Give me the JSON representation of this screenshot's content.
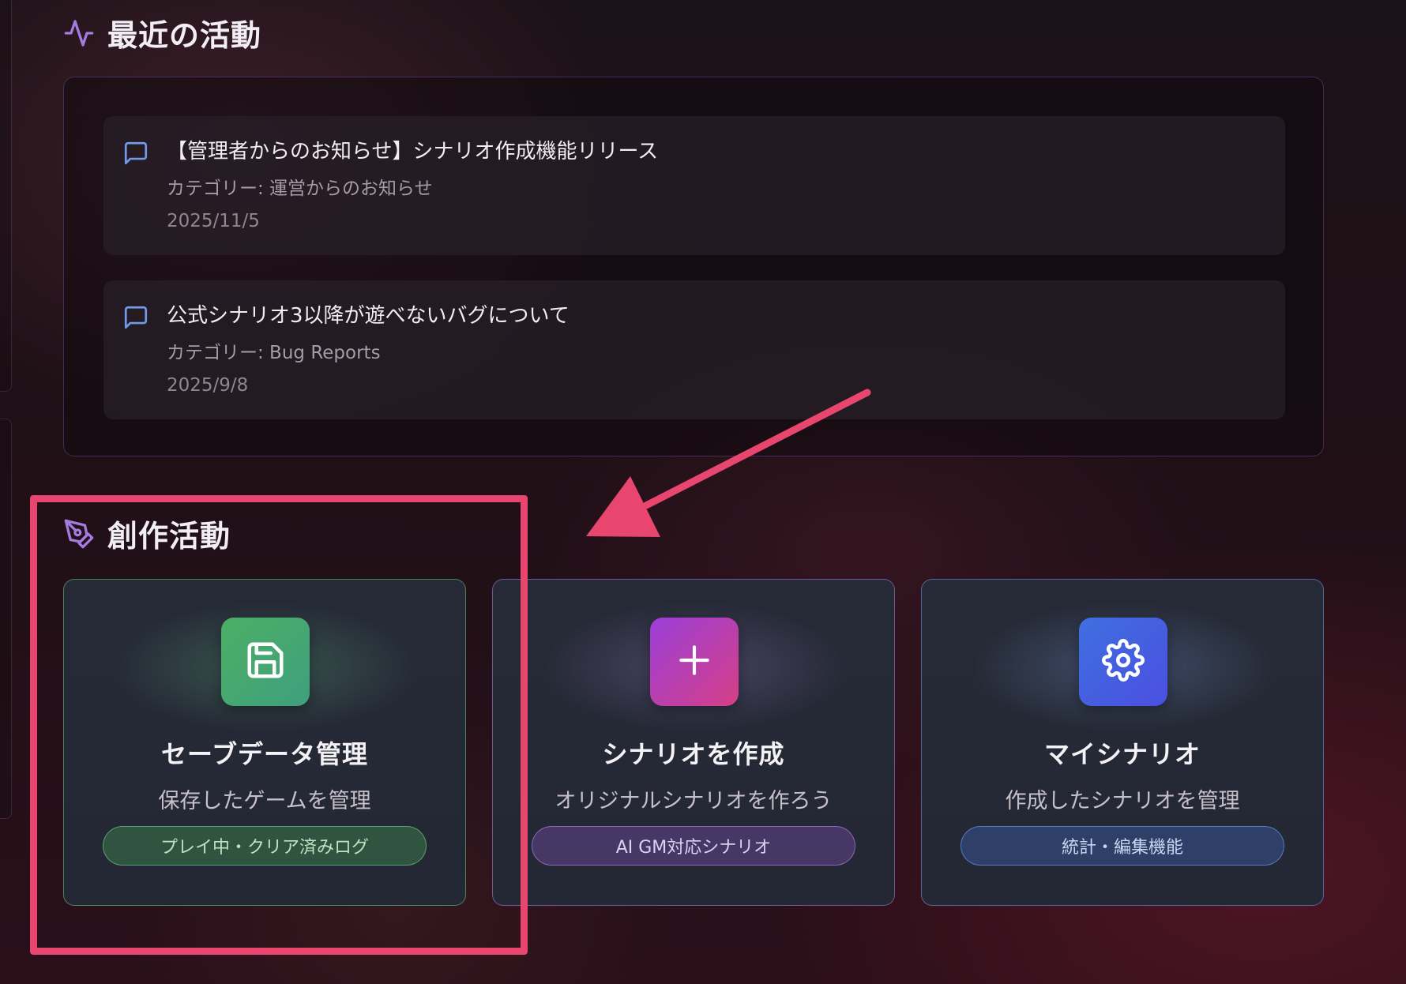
{
  "recent_activity": {
    "heading": "最近の活動",
    "items": [
      {
        "title": "【管理者からのお知らせ】シナリオ作成機能リリース",
        "category": "カテゴリー: 運営からのお知らせ",
        "date": "2025/11/5"
      },
      {
        "title": "公式シナリオ3以降が遊べないバグについて",
        "category": "カテゴリー: Bug Reports",
        "date": "2025/9/8"
      }
    ]
  },
  "creative": {
    "heading": "創作活動",
    "cards": [
      {
        "icon": "save-icon",
        "title": "セーブデータ管理",
        "description": "保存したゲームを管理",
        "tag": "プレイ中・クリア済みログ",
        "color": "#4caf64"
      },
      {
        "icon": "plus-icon",
        "title": "シナリオを作成",
        "description": "オリジナルシナリオを作ろう",
        "tag": "AI GM対応シナリオ",
        "color": "#b13fb8"
      },
      {
        "icon": "gear-icon",
        "title": "マイシナリオ",
        "description": "作成したシナリオを管理",
        "tag": "統計・編集機能",
        "color": "#3f6fe0"
      }
    ]
  },
  "annotation": {
    "color": "#e8456f"
  }
}
